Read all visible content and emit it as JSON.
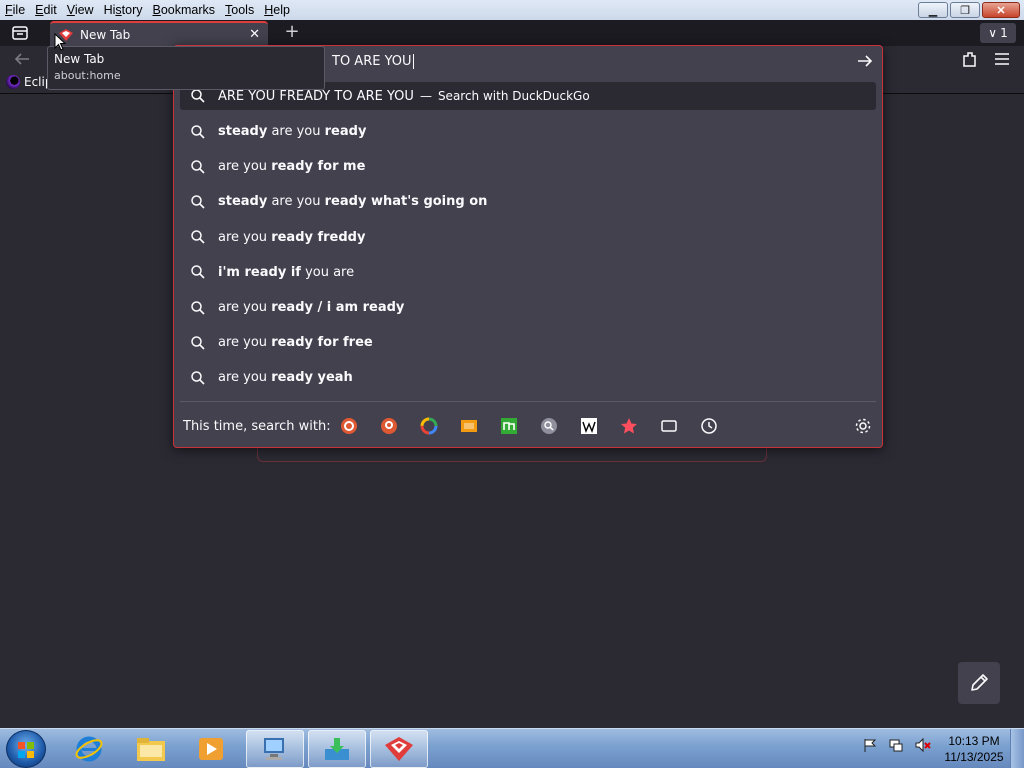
{
  "menubar": {
    "items": [
      {
        "key": "F",
        "rest": "ile"
      },
      {
        "key": "E",
        "rest": "dit"
      },
      {
        "key": "V",
        "rest": "iew"
      },
      {
        "key": "",
        "pre": "Hi",
        "keymid": "s",
        "rest": "tory"
      },
      {
        "key": "B",
        "rest": "ookmarks"
      },
      {
        "key": "T",
        "rest": "ools"
      },
      {
        "key": "H",
        "rest": "elp"
      }
    ],
    "labels": [
      "File",
      "Edit",
      "View",
      "History",
      "Bookmarks",
      "Tools",
      "Help"
    ]
  },
  "tab": {
    "title": "New Tab",
    "close_glyph": "✕",
    "new_glyph": "+"
  },
  "tab_count": {
    "chevron": "∨",
    "count": "1"
  },
  "tooltip": {
    "title": "New Tab",
    "url": "about:home"
  },
  "bookmarks": {
    "first_label": "Eclip"
  },
  "urlbar": {
    "typed": "TO ARE YOU",
    "heuristic": {
      "query": "ARE YOU FREADY TO ARE YOU",
      "dash": "—",
      "action": "Search with DuckDuckGo"
    },
    "suggestions": [
      [
        {
          "t": "steady",
          "b": true
        },
        {
          "t": " are you ",
          "b": false
        },
        {
          "t": "ready",
          "b": true
        }
      ],
      [
        {
          "t": "are you ",
          "b": false
        },
        {
          "t": "ready for me",
          "b": true
        }
      ],
      [
        {
          "t": "steady",
          "b": true
        },
        {
          "t": " are you ",
          "b": false
        },
        {
          "t": "ready what's going on",
          "b": true
        }
      ],
      [
        {
          "t": "are you ",
          "b": false
        },
        {
          "t": "ready freddy",
          "b": true
        }
      ],
      [
        {
          "t": "i'm ready if",
          "b": true
        },
        {
          "t": " you are",
          "b": false
        }
      ],
      [
        {
          "t": "are you ",
          "b": false
        },
        {
          "t": "ready / i am ready",
          "b": true
        }
      ],
      [
        {
          "t": "are you ",
          "b": false
        },
        {
          "t": "ready for free",
          "b": true
        }
      ],
      [
        {
          "t": "are you ",
          "b": false
        },
        {
          "t": "ready yeah",
          "b": true
        }
      ]
    ],
    "oneoff_label": "This time, search with:",
    "engines": [
      "duckduckgo-icon",
      "duckduckgo-alt-icon",
      "google-icon",
      "mg-icon",
      "m-search-icon",
      "magnifier-engine-icon",
      "wikipedia-icon",
      "bookmarks-star-icon",
      "tabs-icon",
      "history-clock-icon"
    ]
  },
  "taskbar": {
    "clock_time": "10:13 PM",
    "clock_date": "11/13/2025"
  },
  "colors": {
    "accent": "#c8323a",
    "panel": "#42414d",
    "bg": "#2b2a33"
  }
}
